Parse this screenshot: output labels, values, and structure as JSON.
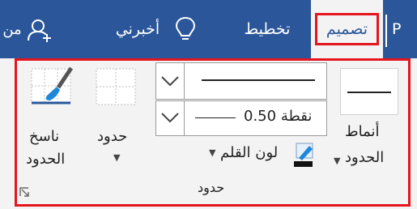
{
  "tabs": {
    "partial_left": "من",
    "tell_me": "أخبرني",
    "layout": "تخطيط",
    "design": "تصميم",
    "partial_right": "P"
  },
  "ribbon": {
    "group_label": "حدود",
    "border_styles_line1": "أنماط",
    "border_styles_line2": "الحدود",
    "pen_weight": "0.50 نقطة",
    "pen_color": "لون القلم",
    "borders_button": "حدود",
    "painter_line1": "ناسخ",
    "painter_line2": "الحدود"
  },
  "colors": {
    "accent": "#2b579a",
    "highlight": "#e4151d"
  }
}
